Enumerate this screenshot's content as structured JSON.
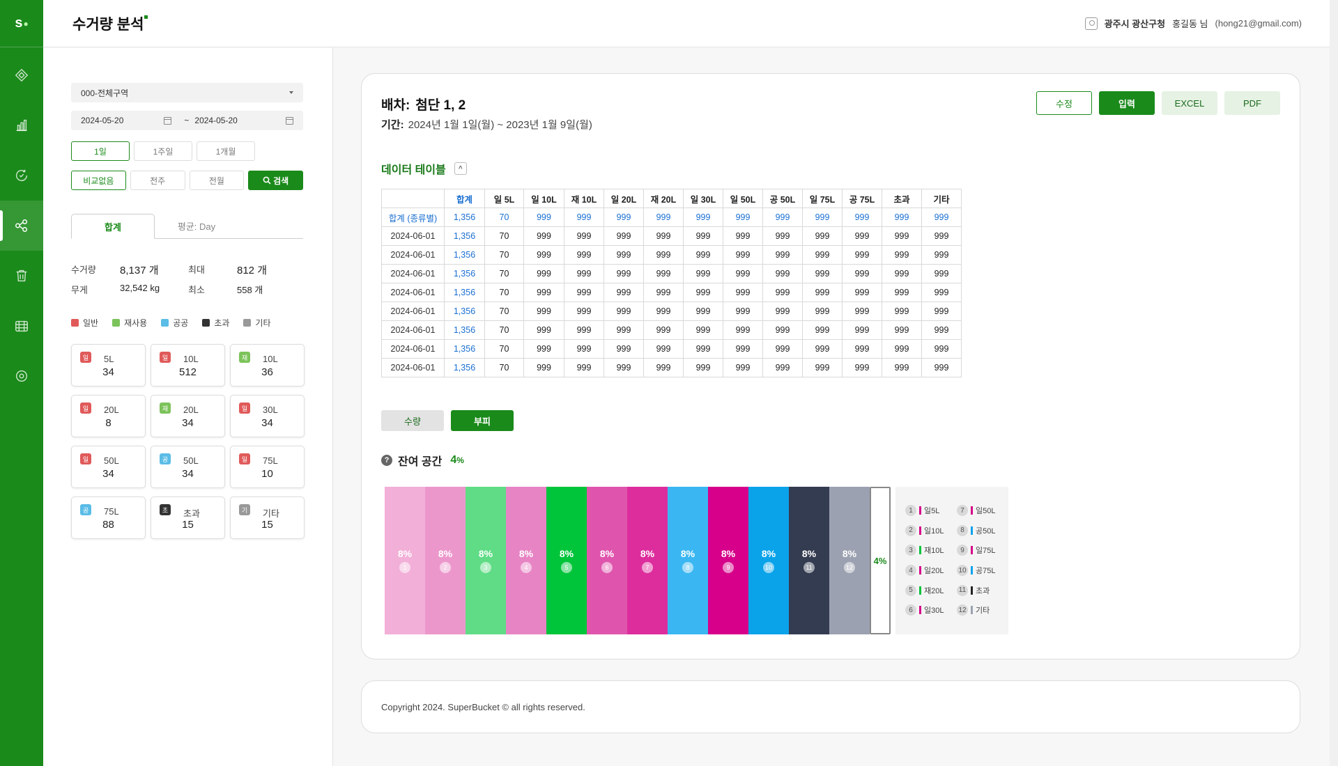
{
  "app": {
    "logo": "s",
    "page_title": "수거량 분석"
  },
  "user": {
    "org": "광주시 광산구청",
    "name": "홍길동 님",
    "email": "(hong21@gmail.com)"
  },
  "rail_icons": [
    "dashboard-icon",
    "bar-chart-icon",
    "recycle-icon",
    "network-icon",
    "trash-icon",
    "calendar-grid-icon",
    "settings-icon"
  ],
  "filter": {
    "region": "000-전체구역",
    "date_from": "2024-05-20",
    "date_sep": "~",
    "date_to": "2024-05-20",
    "periods": [
      "1일",
      "1주일",
      "1개월"
    ],
    "compare": [
      "비교없음",
      "전주",
      "전월"
    ],
    "search_label": "검색",
    "tabs": [
      "합계",
      "평균: Day"
    ],
    "stats": {
      "count_label": "수거량",
      "count": "8,137 개",
      "max_label": "최대",
      "max": "812 개",
      "weight_label": "무게",
      "weight": "32,542 kg",
      "min_label": "최소",
      "min": "558 개"
    },
    "legend": [
      {
        "label": "일반",
        "color": "#e05a5a"
      },
      {
        "label": "재사용",
        "color": "#7cc35b"
      },
      {
        "label": "공공",
        "color": "#5bbce6"
      },
      {
        "label": "초과",
        "color": "#333333"
      },
      {
        "label": "기타",
        "color": "#999999"
      }
    ],
    "cards": [
      {
        "badge": "일",
        "color": "#e05a5a",
        "label": "5L",
        "value": "34"
      },
      {
        "badge": "일",
        "color": "#e05a5a",
        "label": "10L",
        "value": "512"
      },
      {
        "badge": "재",
        "color": "#7cc35b",
        "label": "10L",
        "value": "36"
      },
      {
        "badge": "일",
        "color": "#e05a5a",
        "label": "20L",
        "value": "8"
      },
      {
        "badge": "재",
        "color": "#7cc35b",
        "label": "20L",
        "value": "34"
      },
      {
        "badge": "일",
        "color": "#e05a5a",
        "label": "30L",
        "value": "34"
      },
      {
        "badge": "일",
        "color": "#e05a5a",
        "label": "50L",
        "value": "34"
      },
      {
        "badge": "공",
        "color": "#5bbce6",
        "label": "50L",
        "value": "34"
      },
      {
        "badge": "일",
        "color": "#e05a5a",
        "label": "75L",
        "value": "10"
      },
      {
        "badge": "공",
        "color": "#5bbce6",
        "label": "75L",
        "value": "88"
      },
      {
        "badge": "초",
        "color": "#333333",
        "label": "초과",
        "value": "15"
      },
      {
        "badge": "기",
        "color": "#999999",
        "label": "기타",
        "value": "15"
      }
    ]
  },
  "main": {
    "title_label": "배차:",
    "title_value": "첨단 1, 2",
    "period_label": "기간:",
    "period_value": "2024년 1월 1일(월) ~ 2023년 1월 9일(월)",
    "actions": [
      "수정",
      "입력",
      "EXCEL",
      "PDF"
    ],
    "table_title": "데이터 테이블",
    "collapse_glyph": "^",
    "table": {
      "headers": [
        "",
        "합계",
        "일 5L",
        "일 10L",
        "재 10L",
        "일 20L",
        "재 20L",
        "일 30L",
        "일 50L",
        "공 50L",
        "일 75L",
        "공 75L",
        "초과",
        "기타"
      ],
      "rows": [
        [
          "합계 (종류별)",
          "1,356",
          "70",
          "999",
          "999",
          "999",
          "999",
          "999",
          "999",
          "999",
          "999",
          "999",
          "999",
          "999"
        ],
        [
          "2024-06-01",
          "1,356",
          "70",
          "999",
          "999",
          "999",
          "999",
          "999",
          "999",
          "999",
          "999",
          "999",
          "999",
          "999"
        ],
        [
          "2024-06-01",
          "1,356",
          "70",
          "999",
          "999",
          "999",
          "999",
          "999",
          "999",
          "999",
          "999",
          "999",
          "999",
          "999"
        ],
        [
          "2024-06-01",
          "1,356",
          "70",
          "999",
          "999",
          "999",
          "999",
          "999",
          "999",
          "999",
          "999",
          "999",
          "999",
          "999"
        ],
        [
          "2024-06-01",
          "1,356",
          "70",
          "999",
          "999",
          "999",
          "999",
          "999",
          "999",
          "999",
          "999",
          "999",
          "999",
          "999"
        ],
        [
          "2024-06-01",
          "1,356",
          "70",
          "999",
          "999",
          "999",
          "999",
          "999",
          "999",
          "999",
          "999",
          "999",
          "999",
          "999"
        ],
        [
          "2024-06-01",
          "1,356",
          "70",
          "999",
          "999",
          "999",
          "999",
          "999",
          "999",
          "999",
          "999",
          "999",
          "999",
          "999"
        ],
        [
          "2024-06-01",
          "1,356",
          "70",
          "999",
          "999",
          "999",
          "999",
          "999",
          "999",
          "999",
          "999",
          "999",
          "999",
          "999"
        ],
        [
          "2024-06-01",
          "1,356",
          "70",
          "999",
          "999",
          "999",
          "999",
          "999",
          "999",
          "999",
          "999",
          "999",
          "999",
          "999"
        ]
      ]
    },
    "toggle": [
      "수량",
      "부피"
    ],
    "remain_label": "잔여 공간",
    "remain_value": "4",
    "remain_unit": "%",
    "bars": [
      {
        "pct": "8%",
        "index": "1",
        "color": "#f2afd7"
      },
      {
        "pct": "8%",
        "index": "2",
        "color": "#ec97cc"
      },
      {
        "pct": "8%",
        "index": "3",
        "color": "#5fdc85"
      },
      {
        "pct": "8%",
        "index": "4",
        "color": "#e784c4"
      },
      {
        "pct": "8%",
        "index": "5",
        "color": "#00c43a"
      },
      {
        "pct": "8%",
        "index": "6",
        "color": "#df55ad"
      },
      {
        "pct": "8%",
        "index": "7",
        "color": "#dd2d9d"
      },
      {
        "pct": "8%",
        "index": "8",
        "color": "#3ab7f2"
      },
      {
        "pct": "8%",
        "index": "9",
        "color": "#d6008a"
      },
      {
        "pct": "8%",
        "index": "10",
        "color": "#0aa3ea"
      },
      {
        "pct": "8%",
        "index": "11",
        "color": "#343c51"
      },
      {
        "pct": "8%",
        "index": "12",
        "color": "#9ba1b0"
      }
    ],
    "rest_pct": "4%",
    "bar_legend": [
      {
        "n": "1",
        "label": "일5L",
        "color": "#d6008a"
      },
      {
        "n": "7",
        "label": "일50L",
        "color": "#d6008a"
      },
      {
        "n": "2",
        "label": "일10L",
        "color": "#d6008a"
      },
      {
        "n": "8",
        "label": "공50L",
        "color": "#0aa3ea"
      },
      {
        "n": "3",
        "label": "재10L",
        "color": "#00c43a"
      },
      {
        "n": "9",
        "label": "일75L",
        "color": "#d6008a"
      },
      {
        "n": "4",
        "label": "일20L",
        "color": "#d6008a"
      },
      {
        "n": "10",
        "label": "공75L",
        "color": "#0aa3ea"
      },
      {
        "n": "5",
        "label": "재20L",
        "color": "#00c43a"
      },
      {
        "n": "11",
        "label": "초과",
        "color": "#222222"
      },
      {
        "n": "6",
        "label": "일30L",
        "color": "#d6008a"
      },
      {
        "n": "12",
        "label": "기타",
        "color": "#9ba1b0"
      }
    ]
  },
  "footer": {
    "copyright": "Copyright 2024. SuperBucket © all rights reserved."
  }
}
